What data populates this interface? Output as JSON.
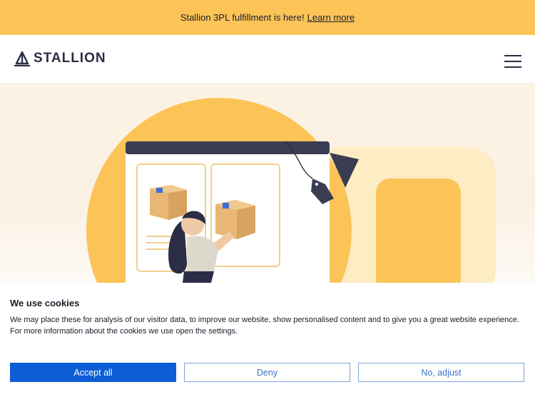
{
  "announcement": {
    "text": "Stallion 3PL fulfillment is here!",
    "link": "Learn more"
  },
  "header": {
    "brand": "STALLION",
    "logo_icon": "sailboat-icon",
    "menu_icon": "hamburger-menu-icon"
  },
  "hero": {
    "illustration": "woman-packing-boxes-illustration"
  },
  "cookie": {
    "title": "We use cookies",
    "body": "We may place these for analysis of our visitor data, to improve our website, show personalised content and to give you a great website experience. For more information about the cookies we use open the settings.",
    "accept": "Accept all",
    "deny": "Deny",
    "adjust": "No, adjust"
  },
  "colors": {
    "banner": "#fcc457",
    "brand_text": "#2a2d45",
    "primary_button": "#0c5dd6",
    "outline_button_text": "#3d73c6"
  }
}
